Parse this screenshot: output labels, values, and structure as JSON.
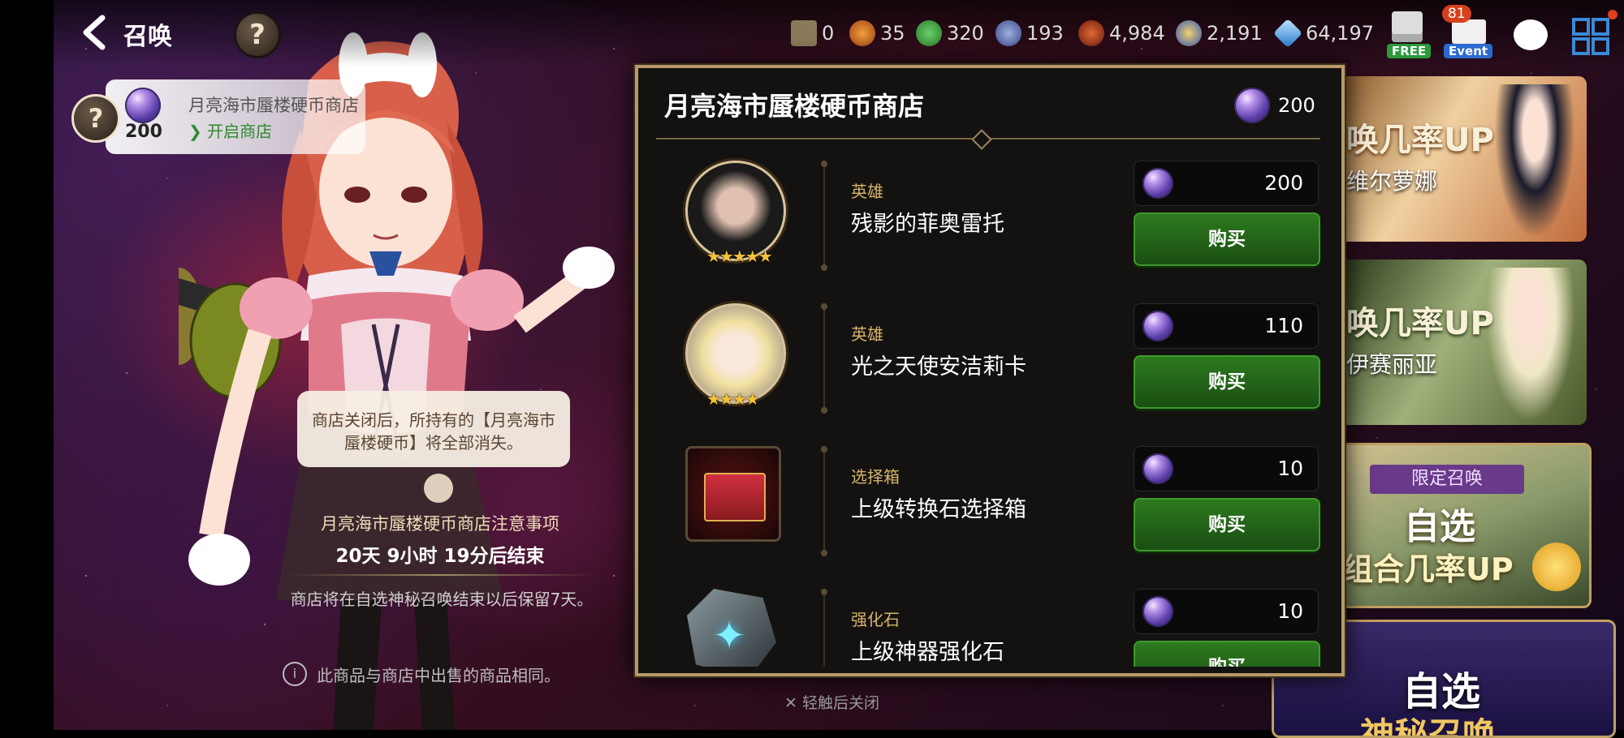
{
  "header": {
    "title": "召唤"
  },
  "resources": [
    {
      "icon": "book-icon",
      "value": "0",
      "color": "#c8b48a"
    },
    {
      "icon": "fire-icon",
      "value": "35",
      "color": "#e07a2a"
    },
    {
      "icon": "clover-icon",
      "value": "320",
      "color": "#3fa044"
    },
    {
      "icon": "mystic-icon",
      "value": "193",
      "color": "#5a6aa8"
    },
    {
      "icon": "dragon-icon",
      "value": "4,984",
      "color": "#a83a1a"
    },
    {
      "icon": "skystone-icon",
      "value": "2,191",
      "color": "#3a6ad8"
    },
    {
      "icon": "crystal-icon",
      "value": "64,197",
      "color": "#4aa8e8"
    }
  ],
  "top_icons": {
    "free_label": "FREE",
    "event_label": "Event",
    "event_badge": "81"
  },
  "shop_chip": {
    "count": "200",
    "name": "月亮海市蜃楼硬币商店",
    "open_label": "开启商店"
  },
  "tooltip": "商店关闭后，所持有的【月亮海市蜃楼硬币】将全部消失。",
  "notice": {
    "title": "月亮海市蜃楼硬币商店注意事项",
    "time": "20天 9小时 19分后结束",
    "keep": "商店将在自选神秘召唤结束以后保留7天。",
    "info": "此商品与商店中出售的商品相同。",
    "tap_close": "轻触后关闭"
  },
  "modal": {
    "title": "月亮海市蜃楼硬币商店",
    "coin_count": "200",
    "buy_label": "购买",
    "items": [
      {
        "category": "英雄",
        "name": "残影的菲奥雷托",
        "price": "200",
        "stars": "★★★★★",
        "kind": "portrait-dark"
      },
      {
        "category": "英雄",
        "name": "光之天使安洁莉卡",
        "price": "110",
        "stars": "★★★★",
        "kind": "portrait-light"
      },
      {
        "category": "选择箱",
        "name": "上级转换石选择箱",
        "price": "10",
        "stars": "",
        "kind": "chest"
      },
      {
        "category": "强化石",
        "name": "上级神器强化石",
        "price": "10",
        "stars": "",
        "kind": "stone"
      }
    ]
  },
  "banners": [
    {
      "line1": "唤几率UP",
      "line2": "维尔萝娜"
    },
    {
      "line1": "唤几率UP",
      "line2": "伊赛丽亚"
    },
    {
      "tag": "限定召唤",
      "line1": "自选",
      "line2": "组合几率UP"
    },
    {
      "line1": "自选",
      "line2": "神秘召唤"
    }
  ]
}
